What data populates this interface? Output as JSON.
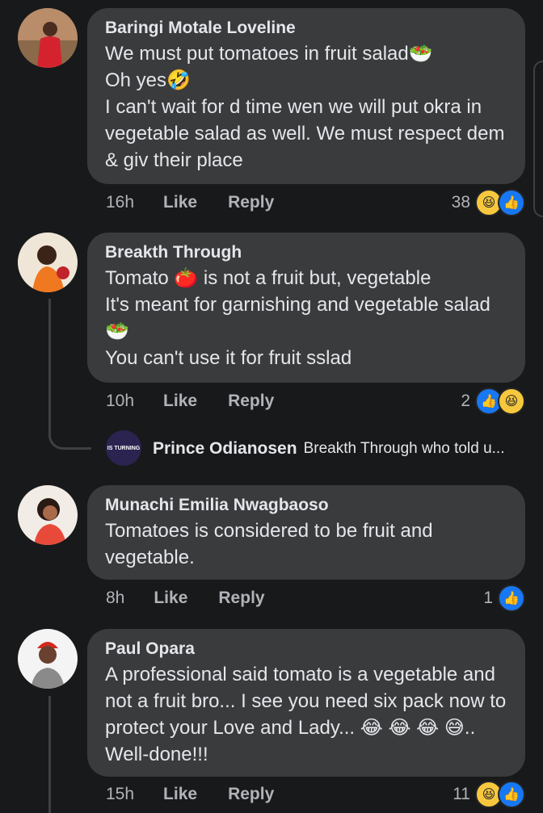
{
  "comments": [
    {
      "author": "Baringi Motale Loveline",
      "lines": [
        "We must put tomatoes in fruit salad🥗",
        "Oh yes🤣",
        "I can't wait for d time wen we will put okra in vegetable salad as well. We must respect dem & giv their place"
      ],
      "time": "16h",
      "like_label": "Like",
      "reply_label": "Reply",
      "reaction_count": "38",
      "reaction_icons": [
        "haha-icon",
        "like-icon"
      ]
    },
    {
      "author": "Breakth Through",
      "lines": [
        "Tomato 🍅 is not a fruit but, vegetable",
        "It's meant for garnishing and vegetable salad🥗",
        "You can't use it for fruit sslad"
      ],
      "time": "10h",
      "like_label": "Like",
      "reply_label": "Reply",
      "reaction_count": "2",
      "reaction_icons": [
        "like-icon",
        "haha-icon"
      ],
      "reply_preview": {
        "author": "Prince Odianosen",
        "text": "Breakth Through who told u...",
        "avatar_text": "IS TURNING"
      }
    },
    {
      "author": "Munachi Emilia Nwagbaoso",
      "lines": [
        "Tomatoes is considered to be fruit and vegetable."
      ],
      "time": "8h",
      "like_label": "Like",
      "reply_label": "Reply",
      "reaction_count": "1",
      "reaction_icons": [
        "like-icon"
      ]
    },
    {
      "author": "Paul Opara",
      "lines": [
        "A professional said tomato is a vegetable and not a fruit bro...  I see you need six pack now to protect your Love and Lady... 😂 😂 😂 😅.. Well-done!!!"
      ],
      "time": "15h",
      "like_label": "Like",
      "reply_label": "Reply",
      "reaction_count": "11",
      "reaction_icons": [
        "haha-icon",
        "like-icon"
      ]
    }
  ],
  "colors": {
    "background": "#18191a",
    "bubble": "#3a3b3c",
    "like_blue": "#1877f2",
    "haha_yellow": "#f7c83d"
  }
}
